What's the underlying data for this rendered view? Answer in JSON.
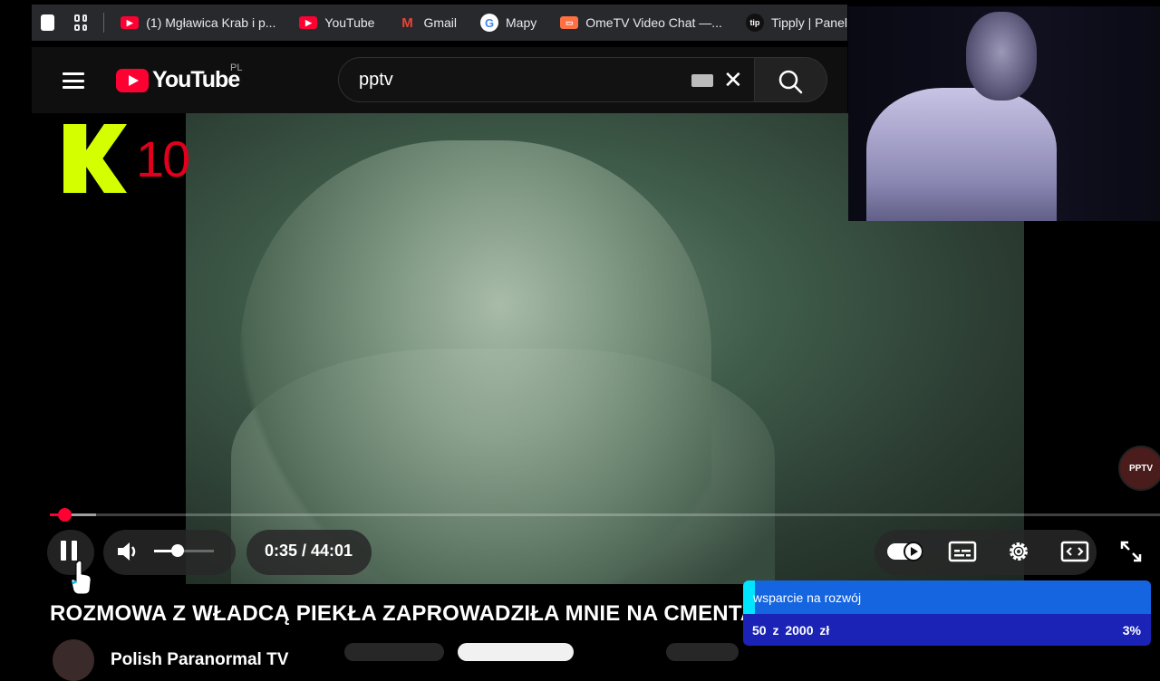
{
  "bookmarks": [
    {
      "label": "(1) Mgławica Krab i p...",
      "icon": "youtube-icon"
    },
    {
      "label": "YouTube",
      "icon": "youtube-icon"
    },
    {
      "label": "Gmail",
      "icon": "gmail-icon"
    },
    {
      "label": "Mapy",
      "icon": "maps-icon"
    },
    {
      "label": "OmeTV Video Chat —...",
      "icon": "ometv-icon"
    },
    {
      "label": "Tipply | Panel",
      "icon": "tipply-icon"
    }
  ],
  "tipply_badge": "tip",
  "header": {
    "logo_text": "YouTube",
    "country_code": "PL",
    "search_value": "pptv"
  },
  "overlay": {
    "k_logo_letter": "K",
    "k_logo_number": "10",
    "watermark_text": "PPTV"
  },
  "player": {
    "time_display": "0:35 / 44:01",
    "progress_fraction": 0.0133,
    "volume_fraction": 0.4
  },
  "video": {
    "title": "ROZMOWA Z WŁADCĄ PIEKŁA ZAPROWADZIŁA MNIE NA CMENTARZ...",
    "channel_name": "Polish Paranormal TV"
  },
  "donation_goal": {
    "title": "wsparcie na rozwój",
    "amount_text": "50 z 2000 zł",
    "percent_text": "3%",
    "percent_value": 0.03
  },
  "colors": {
    "youtube_red": "#ff0033",
    "goal_blue": "#1a23b5",
    "goal_fill": "#1565e0",
    "k_logo_yellow": "#d4ff00"
  }
}
